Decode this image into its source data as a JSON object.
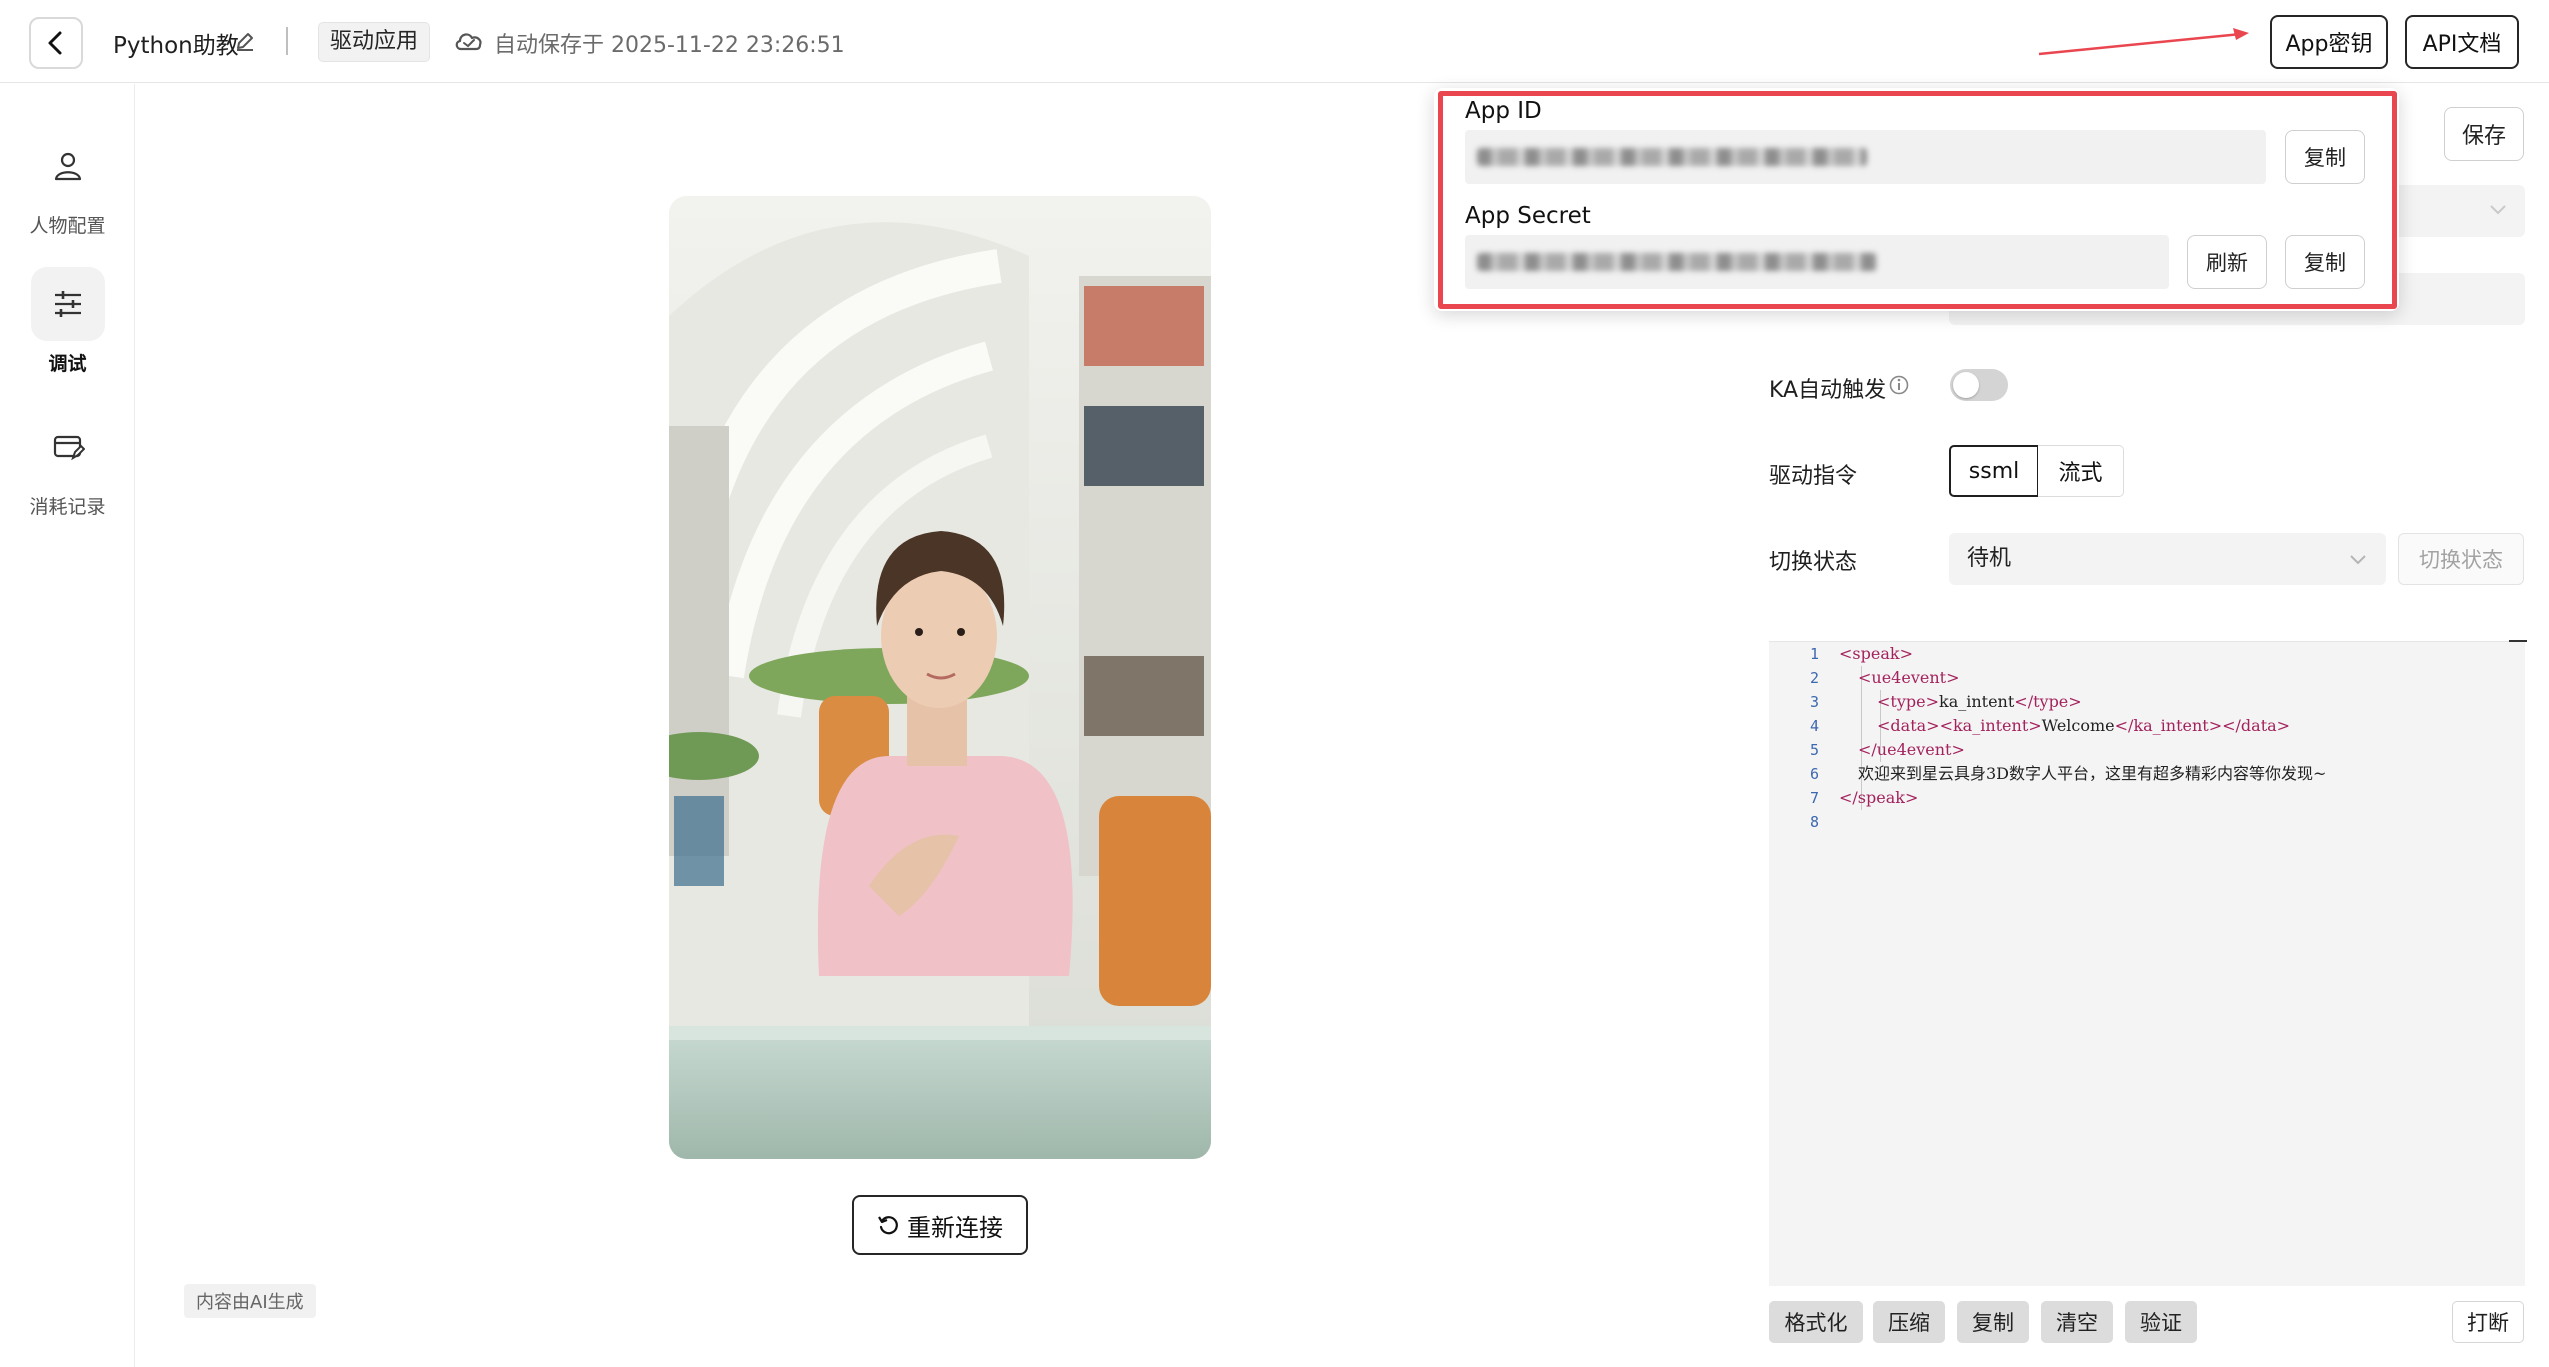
{
  "header": {
    "app_name": "Python助教",
    "tag": "驱动应用",
    "autosave_text": "自动保存于 2025-11-22 23:26:51",
    "app_key_button": "App密钥",
    "api_doc_button": "API文档"
  },
  "sidebar": {
    "items": [
      {
        "label": "人物配置",
        "icon": "person-icon"
      },
      {
        "label": "调试",
        "icon": "sliders-icon",
        "active": true
      },
      {
        "label": "消耗记录",
        "icon": "card-edit-icon"
      }
    ]
  },
  "preview": {
    "reconnect_button": "重新连接",
    "ai_note": "内容由AI生成"
  },
  "settings": {
    "save_button": "保存",
    "ka_label": "KA自动触发",
    "ka_enabled": false,
    "drive_label": "驱动指令",
    "drive_options": [
      "ssml",
      "流式"
    ],
    "drive_selected": "ssml",
    "state_label": "切换状态",
    "state_value": "待机",
    "switch_state_button": "切换状态"
  },
  "editor": {
    "lines": [
      {
        "n": "1",
        "parts": [
          [
            "t",
            "<speak>"
          ]
        ]
      },
      {
        "n": "2",
        "parts": [
          [
            "t",
            "<ue4event>"
          ]
        ]
      },
      {
        "n": "3",
        "parts": [
          [
            "t",
            "<type>"
          ],
          [
            "x",
            "ka_intent"
          ],
          [
            "t",
            "</type>"
          ]
        ]
      },
      {
        "n": "4",
        "parts": [
          [
            "t",
            "<data><ka_intent>"
          ],
          [
            "x",
            "Welcome"
          ],
          [
            "t",
            "</ka_intent></data>"
          ]
        ]
      },
      {
        "n": "5",
        "parts": [
          [
            "t",
            "</ue4event>"
          ]
        ]
      },
      {
        "n": "6",
        "parts": [
          [
            "x",
            "欢迎来到星云具身3D数字人平台，这里有超多精彩内容等你发现~"
          ]
        ]
      },
      {
        "n": "7",
        "parts": [
          [
            "t",
            "</speak>"
          ]
        ]
      },
      {
        "n": "8",
        "parts": []
      }
    ],
    "toolbar": [
      "格式化",
      "压缩",
      "复制",
      "清空",
      "验证"
    ],
    "interrupt_button": "打断"
  },
  "key_popup": {
    "app_id_label": "App ID",
    "app_secret_label": "App Secret",
    "copy_button": "复制",
    "refresh_button": "刷新"
  },
  "colors": {
    "highlight": "#e9464f",
    "xml_tag": "#a3225d",
    "line_number": "#3c68b0"
  }
}
